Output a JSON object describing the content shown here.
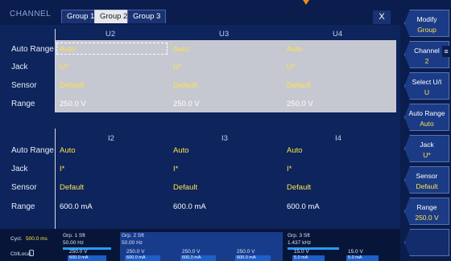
{
  "header": {
    "title": "CHANNEL",
    "tabs": [
      {
        "label": "Group 1",
        "active": false
      },
      {
        "label": "Group 2",
        "active": true
      },
      {
        "label": "Group 3",
        "active": false
      }
    ],
    "close_label": "X"
  },
  "row_labels": {
    "auto_range": "Auto Range",
    "jack": "Jack",
    "sensor": "Sensor",
    "range": "Range"
  },
  "upper": {
    "columns": [
      "U2",
      "U3",
      "U4"
    ],
    "auto_range": [
      "Auto",
      "Auto",
      "Auto"
    ],
    "jack": [
      "U*",
      "U*",
      "U*"
    ],
    "sensor": [
      "Default",
      "Default",
      "Default"
    ],
    "range": [
      "250.0 V",
      "250.0 V",
      "250.0 V"
    ]
  },
  "lower": {
    "columns": [
      "I2",
      "I3",
      "I4"
    ],
    "auto_range": [
      "Auto",
      "Auto",
      "Auto"
    ],
    "jack": [
      "I*",
      "I*",
      "I*"
    ],
    "sensor": [
      "Default",
      "Default",
      "Default"
    ],
    "range": [
      "600.0 mA",
      "600.0 mA",
      "600.0 mA"
    ]
  },
  "softkeys": [
    {
      "label": "Modify",
      "value": "Group"
    },
    {
      "label": "Channel",
      "value": "2"
    },
    {
      "label": "Select U/I",
      "value": "U"
    },
    {
      "label": "Auto Range",
      "value": "Auto"
    },
    {
      "label": "Jack",
      "value": "U*"
    },
    {
      "label": "Sensor",
      "value": "Default"
    },
    {
      "label": "Range",
      "value": "250.0 V"
    },
    {
      "label": "",
      "value": ""
    }
  ],
  "status": {
    "cycle_label": "Cycl.",
    "cycle_value": "500.0 ms",
    "ctrl_label": "Ctrl",
    "ctrl_value": "Local",
    "groups": [
      {
        "name": "Grp. 1 Sft",
        "freq": "50.00 Hz",
        "u": "250.0 V",
        "i": "600.0 mA"
      },
      {
        "name": "Grp. 2 Sft",
        "freq": "50.00 Hz",
        "u1": "250.0 V",
        "i1": "600.0 mA",
        "u2": "250.0 V",
        "i2": "600.0 mA",
        "u3": "250.0 V",
        "i3": "600.0 mA",
        "u4": "250.0 V",
        "i4": "600.0 mA"
      },
      {
        "name": "Grp. 3 Sft",
        "freq": "1.437 kHz",
        "u1": "15.0 V",
        "i1": "5.0 mA",
        "u2": "15.0 V",
        "i2": "5.0 mA"
      }
    ]
  },
  "colors": {
    "background": "#0b1f52",
    "value_yellow": "#ffe24a",
    "selected_block": "#c5c8d0",
    "accent_orange": "#f08a1a"
  },
  "icons": {
    "close": "close-icon",
    "lock": "lock-icon",
    "menu_handle": "menu-handle-icon"
  }
}
